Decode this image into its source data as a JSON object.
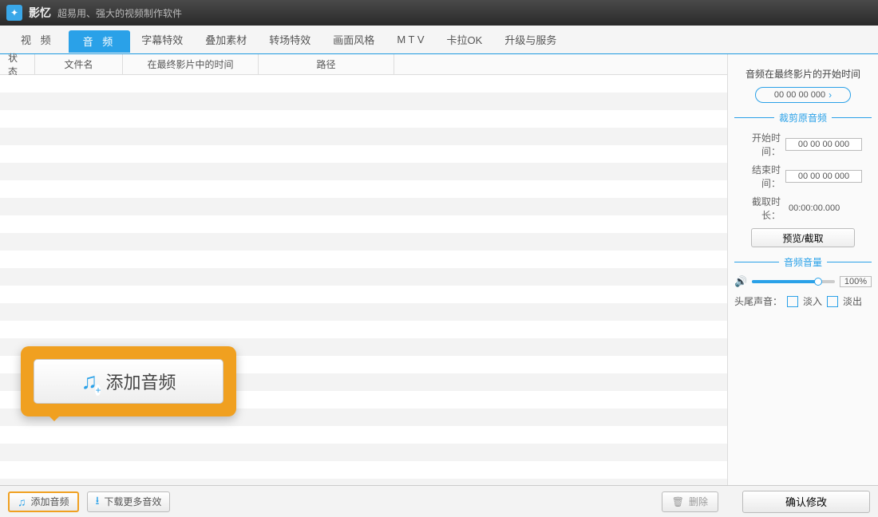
{
  "titlebar": {
    "app_name": "影忆",
    "tagline": "超易用、强大的视频制作软件"
  },
  "tabs": {
    "video": "视 频",
    "audio": "音 频",
    "subtitle": "字幕特效",
    "overlay": "叠加素材",
    "transition": "转场特效",
    "style": "画面风格",
    "mtv": "M T V",
    "karaoke": "卡拉OK",
    "upgrade": "升级与服务"
  },
  "columns": {
    "status": "状态",
    "filename": "文件名",
    "time_in_final": "在最终影片中的时间",
    "path": "路径"
  },
  "right": {
    "start_time_heading": "音频在最终影片的开始时间",
    "start_time_value": "00 00 00 000",
    "trim_section": "裁剪原音频",
    "start_label": "开始时间：",
    "start_value": "00 00 00 000",
    "end_label": "结束时间：",
    "end_value": "00 00 00 000",
    "duration_label": "截取时长：",
    "duration_value": "00:00:00.000",
    "preview_button": "预览/截取",
    "volume_section": "音频音量",
    "volume_value": "100%",
    "fade_label": "头尾声音：",
    "fade_in": "淡入",
    "fade_out": "淡出"
  },
  "bottom": {
    "add_audio": "添加音频",
    "download_more": "下载更多音效",
    "delete": "删除",
    "confirm": "确认修改"
  },
  "callout": {
    "label": "添加音频"
  }
}
